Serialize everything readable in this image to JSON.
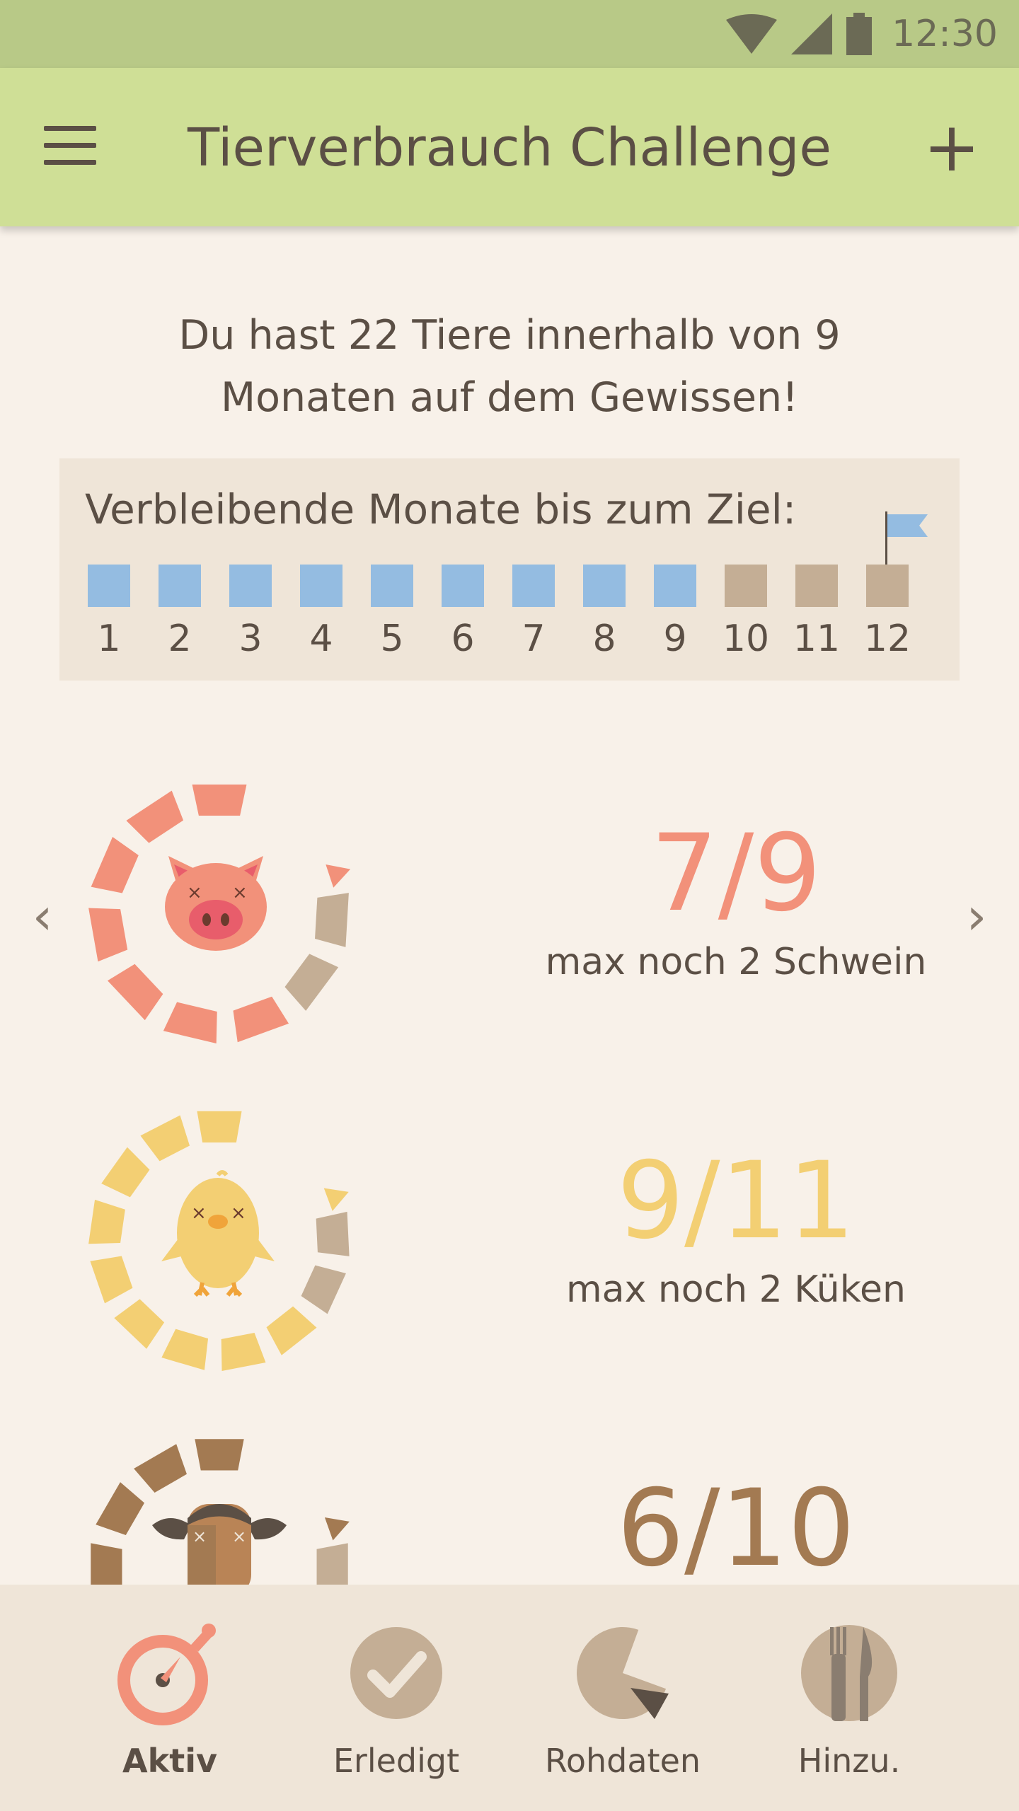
{
  "status": {
    "time": "12:30",
    "icons": [
      "wifi-icon",
      "signal-icon",
      "battery-icon"
    ]
  },
  "appbar": {
    "title": "Tierverbrauch Challenge",
    "menu_icon": "menu-icon",
    "add_label": "+"
  },
  "summary": "Du hast 22 Tiere innerhalb von 9 Monaten auf dem Gewissen!",
  "months": {
    "label": "Verbleibende Monate bis zum Ziel:",
    "items": [
      "1",
      "2",
      "3",
      "4",
      "5",
      "6",
      "7",
      "8",
      "9",
      "10",
      "11",
      "12"
    ],
    "completed": 9,
    "goal_icon": "flag-icon"
  },
  "animals": [
    {
      "name": "pig",
      "count": "7/9",
      "limit": "max noch 2 Schwein",
      "color": "#f2917a",
      "filled": 7,
      "total": 9
    },
    {
      "name": "chick",
      "count": "9/11",
      "limit": "max noch 2 Küken",
      "color": "#f3cf73",
      "filled": 9,
      "total": 11
    },
    {
      "name": "cow",
      "count": "6/10",
      "limit": "",
      "color": "#a37a52",
      "filled": 6,
      "total": 10
    }
  ],
  "colors": {
    "ring_empty": "#c4ae95",
    "month_done": "#94bce1",
    "month_remaining": "#c4ae95"
  },
  "nav": [
    {
      "label": "Aktiv",
      "icon": "stopwatch-icon",
      "active": true
    },
    {
      "label": "Erledigt",
      "icon": "check-icon",
      "active": false
    },
    {
      "label": "Rohdaten",
      "icon": "pie-chart-icon",
      "active": false
    },
    {
      "label": "Hinzu.",
      "icon": "fork-knife-icon",
      "active": false
    }
  ]
}
